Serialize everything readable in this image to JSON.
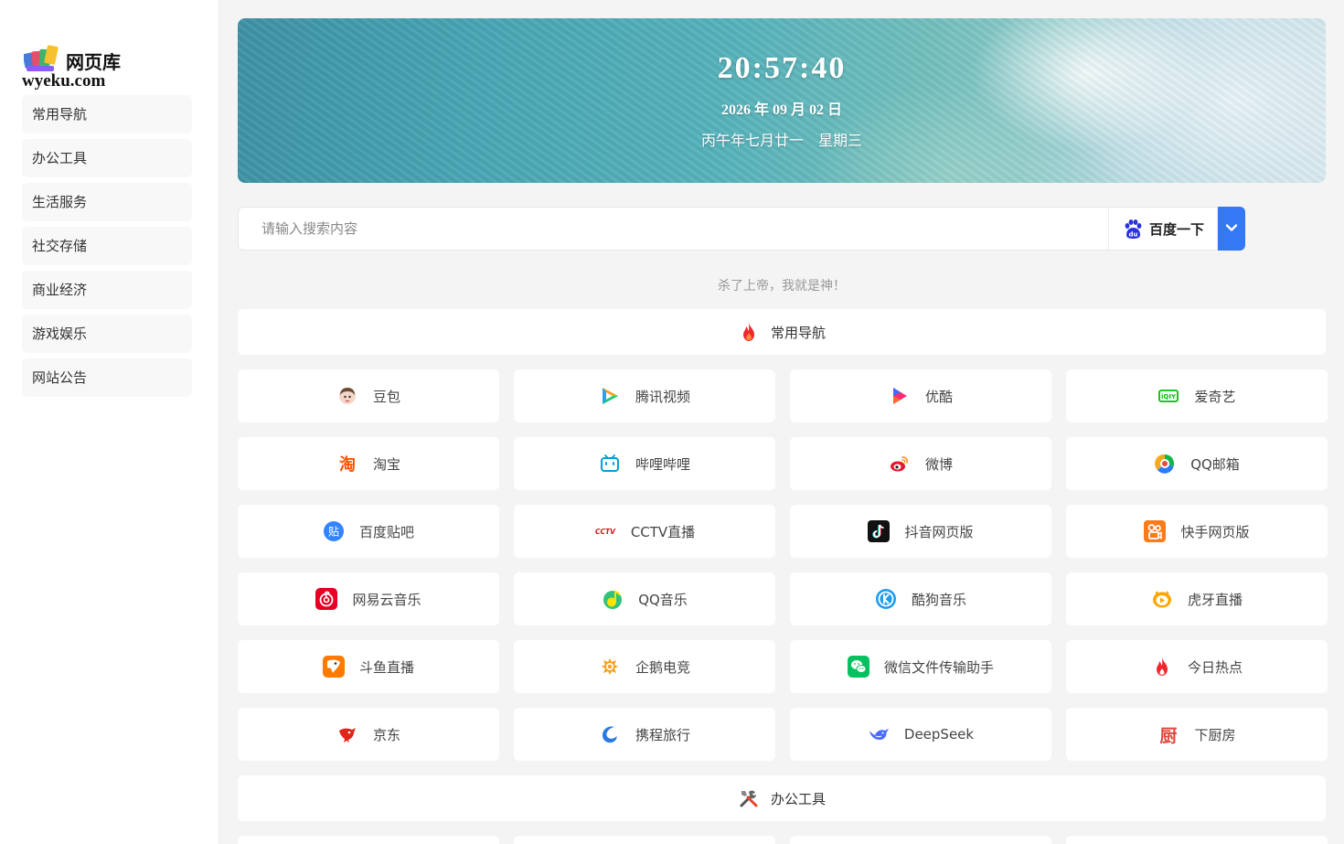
{
  "sidebar": {
    "logo_title": "网页库",
    "logo_domain": "wyeku.com",
    "items": [
      {
        "label": "常用导航"
      },
      {
        "label": "办公工具"
      },
      {
        "label": "生活服务"
      },
      {
        "label": "社交存储"
      },
      {
        "label": "商业经济"
      },
      {
        "label": "游戏娱乐"
      },
      {
        "label": "网站公告"
      }
    ]
  },
  "banner": {
    "time": "20:57:40",
    "date": "2026 年 09 月 02 日",
    "lunar": "丙午年七月廿一",
    "weekday": "星期三"
  },
  "search": {
    "placeholder": "请输入搜索内容",
    "engine_label": "百度一下",
    "engine_icon": "baidu-paw-icon",
    "dropdown_icon": "chevron-down-icon",
    "accent": "#3478f6"
  },
  "slogan": "杀了上帝，我就是神！",
  "sections": [
    {
      "title": "常用导航",
      "icon": "flame-icon"
    },
    {
      "title": "办公工具",
      "icon": "tools-icon"
    }
  ],
  "sites": [
    {
      "name": "豆包",
      "icon": "doubao-icon"
    },
    {
      "name": "腾讯视频",
      "icon": "tencent-video-icon"
    },
    {
      "name": "优酷",
      "icon": "youku-icon"
    },
    {
      "name": "爱奇艺",
      "icon": "iqiyi-icon"
    },
    {
      "name": "淘宝",
      "icon": "taobao-icon"
    },
    {
      "name": "哔哩哔哩",
      "icon": "bilibili-icon"
    },
    {
      "name": "微博",
      "icon": "weibo-icon"
    },
    {
      "name": "QQ邮箱",
      "icon": "qq-mail-icon"
    },
    {
      "name": "百度贴吧",
      "icon": "tieba-icon"
    },
    {
      "name": "CCTV直播",
      "icon": "cctv-icon"
    },
    {
      "name": "抖音网页版",
      "icon": "douyin-icon"
    },
    {
      "name": "快手网页版",
      "icon": "kuaishou-icon"
    },
    {
      "name": "网易云音乐",
      "icon": "netease-music-icon"
    },
    {
      "name": "QQ音乐",
      "icon": "qq-music-icon"
    },
    {
      "name": "酷狗音乐",
      "icon": "kugou-icon"
    },
    {
      "name": "虎牙直播",
      "icon": "huya-icon"
    },
    {
      "name": "斗鱼直播",
      "icon": "douyu-icon"
    },
    {
      "name": "企鹅电竞",
      "icon": "penguin-esports-icon"
    },
    {
      "name": "微信文件传输助手",
      "icon": "wechat-icon"
    },
    {
      "name": "今日热点",
      "icon": "toutiao-flame-icon"
    },
    {
      "name": "京东",
      "icon": "jd-icon"
    },
    {
      "name": "携程旅行",
      "icon": "ctrip-icon"
    },
    {
      "name": "DeepSeek",
      "icon": "deepseek-icon"
    },
    {
      "name": "下厨房",
      "icon": "xiachufang-icon"
    }
  ],
  "icon_texts": {
    "taobao": "淘",
    "tieba": "贴",
    "cctv": "CCTV",
    "iqiyi": "iQIY",
    "xiachufang": "厨",
    "baidu": "du"
  }
}
